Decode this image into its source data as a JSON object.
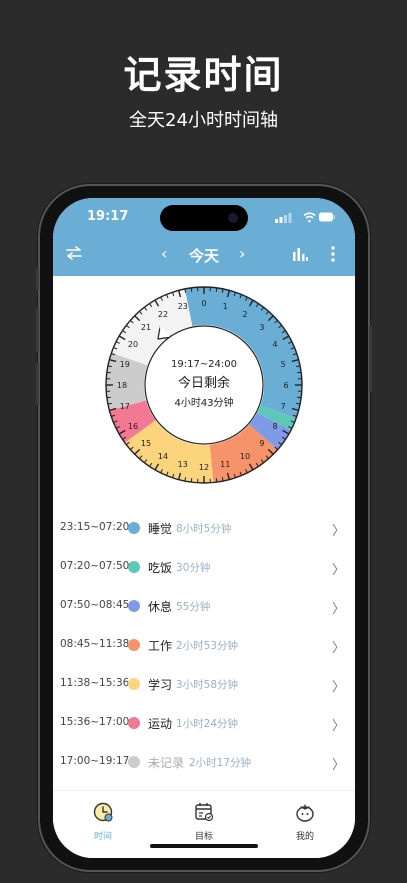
{
  "promo": {
    "title": "记录时间",
    "subtitle": "全天24小时时间轴"
  },
  "status": {
    "time": "19:17"
  },
  "nav": {
    "title": "今天",
    "prev": "‹",
    "next": "›",
    "icons": [
      "swap-icon",
      "bar-chart-icon",
      "more-vertical-icon"
    ]
  },
  "colors": {
    "accent": "#6aaed6",
    "sleep": "#6aaed6",
    "eat": "#5cc9b8",
    "rest": "#7f9ae6",
    "work": "#f7936a",
    "study": "#fdd47e",
    "sport": "#f27893",
    "unrecorded": "#cccccc"
  },
  "clock": {
    "center_range": "19:17~24:00",
    "center_label": "今日剩余",
    "center_remain": "4小时43分钟",
    "hour_labels": [
      "0",
      "1",
      "2",
      "3",
      "4",
      "5",
      "6",
      "7",
      "8",
      "9",
      "10",
      "11",
      "12",
      "13",
      "14",
      "15",
      "16",
      "17",
      "18",
      "19",
      "20",
      "21",
      "22",
      "23"
    ],
    "segments": [
      {
        "from": "23:15",
        "to": "07:20",
        "color": "#6aaed6"
      },
      {
        "from": "07:20",
        "to": "07:50",
        "color": "#5cc9b8"
      },
      {
        "from": "07:50",
        "to": "08:45",
        "color": "#7f9ae6"
      },
      {
        "from": "08:45",
        "to": "11:38",
        "color": "#f7936a"
      },
      {
        "from": "11:38",
        "to": "15:36",
        "color": "#fdd47e"
      },
      {
        "from": "15:36",
        "to": "17:00",
        "color": "#f27893"
      },
      {
        "from": "17:00",
        "to": "19:17",
        "color": "#cccccc"
      },
      {
        "from": "19:17",
        "to": "23:15",
        "color": "#f3f3f3"
      }
    ]
  },
  "entries": [
    {
      "time": "23:15~07:20",
      "name": "睡觉",
      "duration": "8小时5分钟",
      "color": "#6aaed6"
    },
    {
      "time": "07:20~07:50",
      "name": "吃饭",
      "duration": "30分钟",
      "color": "#5cc9b8"
    },
    {
      "time": "07:50~08:45",
      "name": "休息",
      "duration": "55分钟",
      "color": "#7f9ae6"
    },
    {
      "time": "08:45~11:38",
      "name": "工作",
      "duration": "2小时53分钟",
      "color": "#f7936a"
    },
    {
      "time": "11:38~15:36",
      "name": "学习",
      "duration": "3小时58分钟",
      "color": "#fdd47e"
    },
    {
      "time": "15:36~17:00",
      "name": "运动",
      "duration": "1小时24分钟",
      "color": "#f27893"
    },
    {
      "time": "17:00~19:17",
      "name": "未记录",
      "duration": "2小时17分钟",
      "color": "#cccccc"
    }
  ],
  "tabs": [
    {
      "label": "时间",
      "icon": "clock-icon"
    },
    {
      "label": "目标",
      "icon": "calendar-target-icon"
    },
    {
      "label": "我的",
      "icon": "tomato-icon"
    }
  ]
}
